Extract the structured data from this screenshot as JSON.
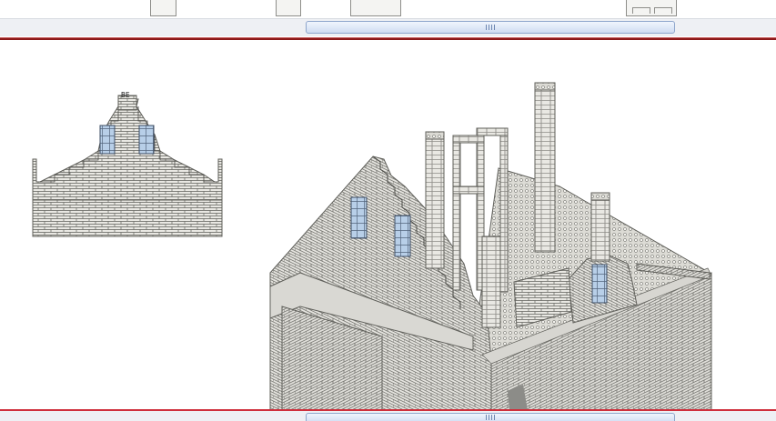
{
  "top_scrollbar": {
    "grip_icon": "grip-lines-icon"
  },
  "bottom_scrollbar": {
    "grip_icon": "grip-lines-icon"
  },
  "workspace": {
    "front_view": {
      "label_tag": "BE"
    },
    "iso_view": {}
  },
  "colors": {
    "brick_fill": "#e9e8e3",
    "brick_line": "#5f5f5a",
    "window_fill": "#b8cfe8",
    "divider_red": "#8c1818",
    "scroll_thumb": "#cfdcf2"
  }
}
